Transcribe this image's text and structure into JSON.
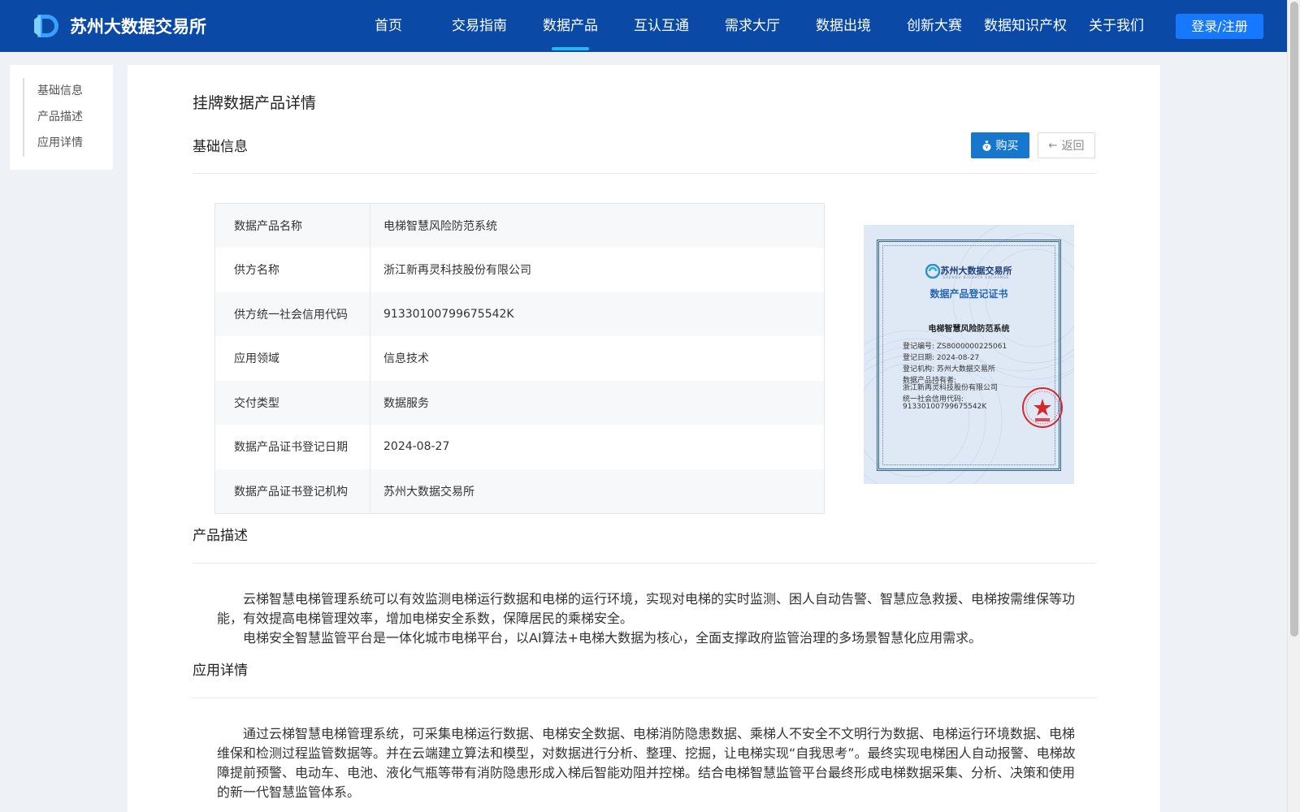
{
  "header": {
    "brand": "苏州大数据交易所",
    "nav": [
      "首页",
      "交易指南",
      "数据产品",
      "互认互通",
      "需求大厅",
      "数据出境",
      "创新大赛",
      "数据知识产权",
      "关于我们"
    ],
    "active_nav": "数据产品",
    "login_label": "登录/注册",
    "colors": {
      "bar": "#0a4aa6",
      "active_underline": "#27b7f2",
      "login": "#1677ff"
    }
  },
  "sidenav": {
    "items": [
      "基础信息",
      "产品描述",
      "应用详情"
    ]
  },
  "main": {
    "page_title": "挂牌数据产品详情",
    "basic_section_title": "基础信息",
    "buy_label": "购买",
    "back_label": "返回",
    "info_rows": [
      {
        "key": "数据产品名称",
        "value": "电梯智慧风险防范系统"
      },
      {
        "key": "供方名称",
        "value": "浙江新再灵科技股份有限公司"
      },
      {
        "key": "供方统一社会信用代码",
        "value": "91330100799675542K"
      },
      {
        "key": "应用领域",
        "value": "信息技术"
      },
      {
        "key": "交付类型",
        "value": "数据服务"
      },
      {
        "key": "数据产品证书登记日期",
        "value": "2024-08-27"
      },
      {
        "key": "数据产品证书登记机构",
        "value": "苏州大数据交易所"
      }
    ],
    "certificate": {
      "org": "苏州大数据交易所",
      "org_en": "SUZHOU BIGDATA EXCHANGE",
      "title": "数据产品登记证书",
      "product": "电梯智慧风险防范系统",
      "lines": [
        "登记编号: ZS8000000225061",
        "登记日期: 2024-08-27",
        "登记机构: 苏州大数据交易所",
        "数据产品持有者:",
        "浙江新再灵科技股份有限公司",
        "统一社会信用代码:",
        "91330100799675542K"
      ]
    },
    "desc_section_title": "产品描述",
    "desc_paragraphs": [
      "云梯智慧电梯管理系统可以有效监测电梯运行数据和电梯的运行环境，实现对电梯的实时监测、困人自动告警、智慧应急救援、电梯按需维保等功能，有效提高电梯管理效率，增加电梯安全系数，保障居民的乘梯安全。",
      "电梯安全智慧监管平台是一体化城市电梯平台，以AI算法+电梯大数据为核心，全面支撑政府监管治理的多场景智慧化应用需求。"
    ],
    "app_section_title": "应用详情",
    "app_paragraphs": [
      "通过云梯智慧电梯管理系统，可采集电梯运行数据、电梯安全数据、电梯消防隐患数据、乘梯人不安全不文明行为数据、电梯运行环境数据、电梯维保和检测过程监管数据等。并在云端建立算法和模型，对数据进行分析、整理、挖掘，让电梯实现“自我思考”。最终实现电梯困人自动报警、电梯故障提前预警、电动车、电池、液化气瓶等带有消防隐患形成入梯后智能劝阻并控梯。结合电梯智慧监管平台最终形成电梯数据采集、分析、决策和使用的新一代智慧监管体系。"
    ]
  }
}
